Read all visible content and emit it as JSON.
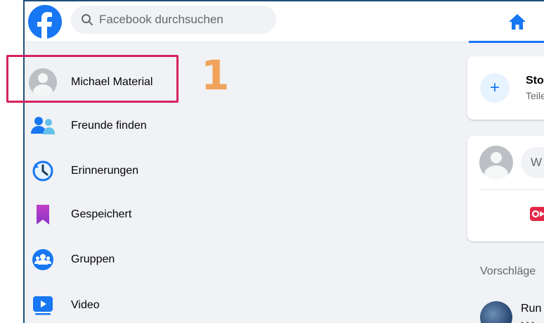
{
  "topbar": {
    "search_placeholder": "Facebook durchsuchen"
  },
  "sidebar": {
    "items": [
      {
        "label": "Michael Material",
        "icon": "profile-avatar"
      },
      {
        "label": "Freunde finden",
        "icon": "friends-icon"
      },
      {
        "label": "Erinnerungen",
        "icon": "memories-clock-icon"
      },
      {
        "label": "Gespeichert",
        "icon": "saved-bookmark-icon"
      },
      {
        "label": "Gruppen",
        "icon": "groups-icon"
      },
      {
        "label": "Video",
        "icon": "video-play-icon"
      }
    ]
  },
  "feed": {
    "story_title": "Sto",
    "story_subtitle": "Teile",
    "post_prompt": "W",
    "suggestions_title": "Vorschläge",
    "suggestion_name": "Run"
  },
  "annotation": {
    "step": "1"
  },
  "colors": {
    "brand": "#1877f2",
    "highlight": "#d6235d",
    "step_number": "#f0a35b"
  }
}
